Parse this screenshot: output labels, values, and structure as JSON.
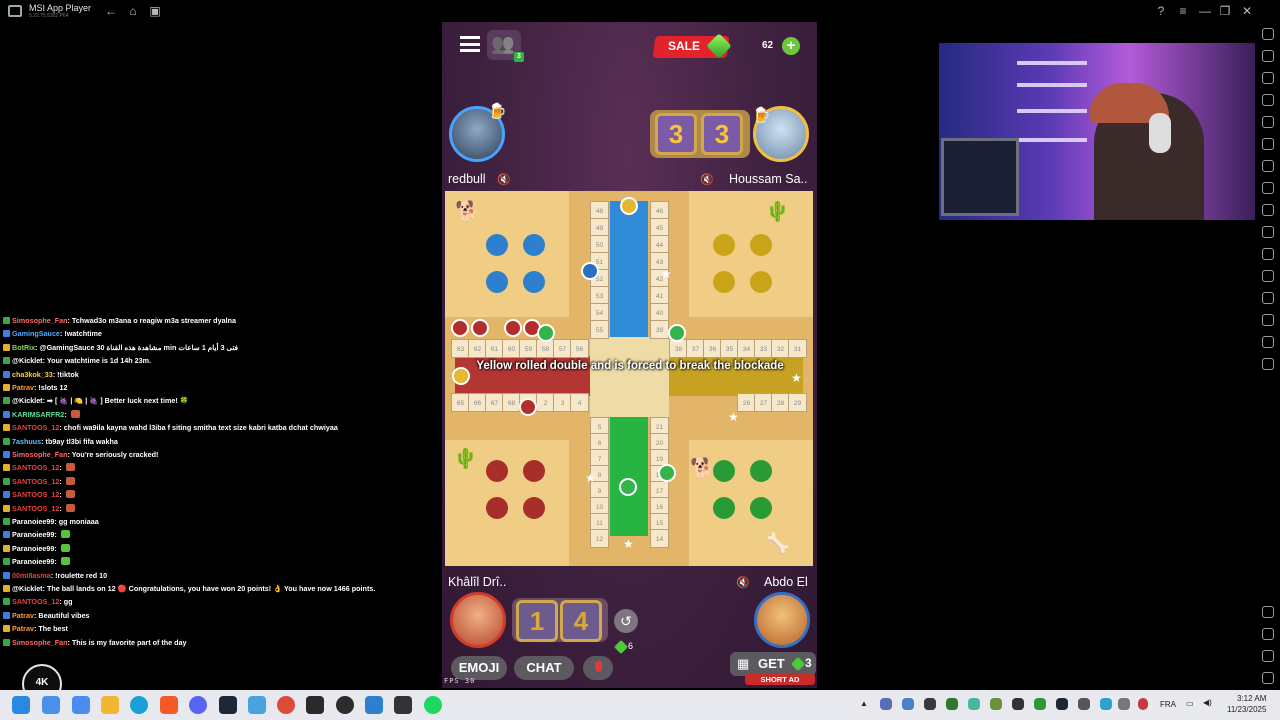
{
  "window": {
    "title": "MSI App Player",
    "version": "5.22.75.5302 P64"
  },
  "titlebar_icons": [
    "back-icon",
    "home-icon",
    "tabs-icon",
    "help-icon",
    "menu-icon",
    "minimize-icon",
    "restore-icon",
    "close-icon"
  ],
  "chat": {
    "messages": [
      {
        "user": "Simosophe_Fan",
        "user_color": "#ff6a6a",
        "text": ": Tchwad3o m3ana o reagiw m3a streamer dyalna"
      },
      {
        "user": "GamingSauce",
        "user_color": "#56a8ff",
        "text": ": !watchtime"
      },
      {
        "user": "BotRix",
        "user_color": "#8bd05a",
        "text": ": @GamingSauce 30 مشاهدة هذه القناة min فتى 3 أيام 1 ساعات"
      },
      {
        "user": "@Kicklet",
        "user_color": "#ffffff",
        "text": ": Your watchtime is 1d 14h 23m."
      },
      {
        "user": "cha3kok_33",
        "user_color": "#ffd24a",
        "text": ": !tiktok"
      },
      {
        "user": "Patrav",
        "user_color": "#ff9a3c",
        "text": ": !slots 12"
      },
      {
        "user": "@Kicklet",
        "user_color": "#ffffff",
        "text": ": ➡ [ 🍇 | 🍋 | 🍇 ] Better luck next time! 🍀"
      },
      {
        "user": "KARIMSARFR2",
        "user_color": "#58e0a0",
        "text": ": "
      },
      {
        "user": "SANTOOS_12",
        "user_color": "#e8413c",
        "text": ": chofi wa9ila kayna wahd l3iba f siting smitha text size kabri katba dchat chwiyaa"
      },
      {
        "user": "7ashuus",
        "user_color": "#56c7ff",
        "text": ": tb9ay tl3bi fifa wakha"
      },
      {
        "user": "Simosophe_Fan",
        "user_color": "#ff6a6a",
        "text": ": You're seriously cracked!"
      },
      {
        "user": "SANTOOS_12",
        "user_color": "#e8413c",
        "text": ": "
      },
      {
        "user": "SANTOOS_12",
        "user_color": "#e8413c",
        "text": ": "
      },
      {
        "user": "SANTOOS_12",
        "user_color": "#e8413c",
        "text": ": "
      },
      {
        "user": "SANTOOS_12",
        "user_color": "#e8413c",
        "text": ": "
      },
      {
        "user": "Paranoiee99",
        "user_color": "#ffffff",
        "text": ": gg moniaaa"
      },
      {
        "user": "Paranoiee99",
        "user_color": "#ffffff",
        "text": ": "
      },
      {
        "user": "Paranoiee99",
        "user_color": "#ffffff",
        "text": ": "
      },
      {
        "user": "Paranoiee99",
        "user_color": "#ffffff",
        "text": ": "
      },
      {
        "user": "00mI8asma",
        "user_color": "#e8413c",
        "text": ": !roulette red 10"
      },
      {
        "user": "@Kicklet",
        "user_color": "#ffffff",
        "text": ": The ball lands on 12 🔴 Congratulations, you have won 20 points! 👌 You have now 1466 points."
      },
      {
        "user": "SANTOOS_12",
        "user_color": "#e8413c",
        "text": ": gg"
      },
      {
        "user": "Patrav",
        "user_color": "#ff9a3c",
        "text": ": Beautiful vibes"
      },
      {
        "user": "Patrav",
        "user_color": "#ff9a3c",
        "text": ": The best"
      },
      {
        "user": "Simosophe_Fan",
        "user_color": "#ff6a6a",
        "text": ": This is my favorite part of the day"
      }
    ],
    "channel_logo": "4K"
  },
  "game": {
    "sale_label": "SALE",
    "gems": "62",
    "friends_online": "3",
    "top_left_player": "redbull",
    "top_right_player": "Houssam Sa..",
    "bottom_left_player": "Khâlîl Drî..",
    "bottom_right_player": "Abdo El",
    "top_dice": [
      "3",
      "3"
    ],
    "bottom_dice": [
      "1",
      "4"
    ],
    "board_notice": "Yellow rolled double and is forced to break the blockade",
    "gems_small": "6",
    "buttons": {
      "emoji": "EMOJI",
      "chat": "CHAT",
      "get": "GET",
      "get_count": "3",
      "short_ad": "SHORT AD"
    },
    "fps_label": "FPS",
    "fps": "30",
    "track_top": [
      "48",
      "49",
      "50",
      "51",
      "52",
      "53",
      "54",
      "55",
      "46",
      "45",
      "44",
      "43",
      "42",
      "41",
      "40",
      "39"
    ],
    "track_left_top": [
      "63",
      "62",
      "61",
      "60",
      "59",
      "58",
      "57",
      "56"
    ],
    "track_left_bottom": [
      "65",
      "66",
      "67",
      "68",
      "1",
      "2",
      "3",
      "4"
    ],
    "track_right_top": [
      "38",
      "37",
      "36",
      "35",
      "34",
      "33",
      "32",
      "31"
    ],
    "track_right_bottom": [
      "26",
      "27",
      "28",
      "29"
    ],
    "track_bottom": [
      "5",
      "6",
      "7",
      "8",
      "9",
      "10",
      "11",
      "12",
      "21",
      "20",
      "19",
      "18",
      "17",
      "16",
      "15",
      "14"
    ],
    "colors": {
      "blue": "#2f7fcf",
      "yellow": "#c9a418",
      "red": "#a82e2b",
      "green": "#2a9a35"
    }
  },
  "taskbar": {
    "language": "FRA",
    "time": "3:12 AM",
    "date": "11/23/2025"
  }
}
